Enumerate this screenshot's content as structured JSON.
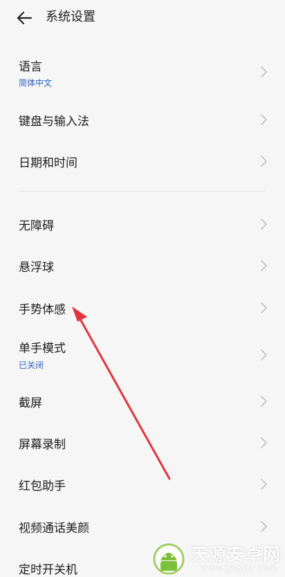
{
  "header": {
    "title": "系统设置",
    "back_icon": "arrow-left-icon"
  },
  "section1": [
    {
      "label": "语言",
      "sub": "简体中文"
    },
    {
      "label": "键盘与输入法"
    },
    {
      "label": "日期和时间"
    }
  ],
  "section2": [
    {
      "label": "无障碍"
    },
    {
      "label": "悬浮球"
    },
    {
      "label": "手势体感"
    },
    {
      "label": "单手模式",
      "sub": "已关闭"
    },
    {
      "label": "截屏"
    },
    {
      "label": "屏幕录制"
    },
    {
      "label": "红包助手"
    },
    {
      "label": "视频通话美颜"
    },
    {
      "label": "定时开关机"
    }
  ],
  "colors": {
    "accent": "#2a62c8",
    "annotation_arrow": "#e0343d",
    "background": "#f6f6f6"
  },
  "watermark": {
    "name": "天源安卓网",
    "url": "www.jytyaz.com"
  }
}
